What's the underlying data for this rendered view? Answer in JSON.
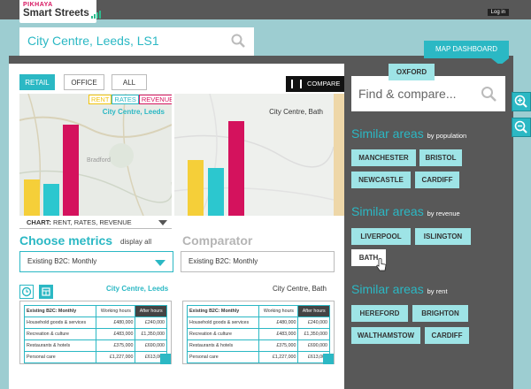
{
  "brand": {
    "top": "PIKHAYA",
    "name": "Smart Streets"
  },
  "header": {
    "login": "Log in",
    "location": "City Centre, Leeds, LS1",
    "map_dashboard": "MAP DASHBOARD"
  },
  "tabs": [
    "RETAIL",
    "OFFICE",
    "ALL"
  ],
  "compare_label": "COMPARE",
  "legend": {
    "rent": "RENT",
    "rates": "RATES",
    "revenue": "REVENUE"
  },
  "maps": {
    "left_label": "City Centre, Leeds",
    "right_label": "City Centre, Bath",
    "map_text": "Bradford"
  },
  "chart_select": {
    "prefix": "CHART:",
    "value": "RENT, RATES, REVENUE"
  },
  "metrics": {
    "title": "Choose metrics",
    "display_all": "display all",
    "comparator_title": "Comparator",
    "select1": "Existing B2C: Monthly",
    "select2": "Existing B2C: Monthly"
  },
  "table_labels": {
    "left": "City Centre, Leeds",
    "right": "City Centre, Bath"
  },
  "table": {
    "header": [
      "Existing B2C: Monthly",
      "Working hours",
      "After hours"
    ],
    "rows": [
      [
        "Household goods & services",
        "£480,000",
        "£240,000"
      ],
      [
        "Recreation & culture",
        "£483,000",
        "£1,350,000"
      ],
      [
        "Restaurants & hotels",
        "£375,000",
        "£690,000"
      ],
      [
        "Personal care",
        "£1,227,000",
        "£613,000"
      ]
    ]
  },
  "chart_data": [
    {
      "type": "bar",
      "categories": [
        "RENT",
        "RATES",
        "REVENUE"
      ],
      "values": [
        40,
        35,
        100
      ],
      "ylim": [
        0,
        100
      ],
      "colors": [
        "#f5cf39",
        "#2cc7cf",
        "#d4125d"
      ]
    },
    {
      "type": "bar",
      "categories": [
        "RENT",
        "RATES",
        "REVENUE"
      ],
      "values": [
        59,
        50,
        100
      ],
      "ylim": [
        0,
        100
      ],
      "colors": [
        "#f5cf39",
        "#2cc7cf",
        "#d4125d"
      ]
    }
  ],
  "right_panel": {
    "search_placeholder": "Find & compare...",
    "groups": [
      {
        "title": "Similar areas",
        "sub": "by population",
        "chips": [
          "MANCHESTER",
          "BRISTOL",
          "NEWCASTLE",
          "CARDIFF"
        ]
      },
      {
        "title": "Similar areas",
        "sub": "by revenue",
        "chips": [
          "LIVERPOOL",
          "ISLINGTON",
          "BATH",
          "OXFORD"
        ]
      },
      {
        "title": "Similar areas",
        "sub": "by rent",
        "chips": [
          "HEREFORD",
          "BRIGHTON",
          "WALTHAMSTOW",
          "CARDIFF"
        ]
      }
    ]
  },
  "colors": {
    "accent": "#2bb8c4",
    "dark": "#585858",
    "bg": "#9dcdd1",
    "rent": "#f5cf39",
    "rates": "#2cc7cf",
    "revenue": "#d4125d"
  }
}
